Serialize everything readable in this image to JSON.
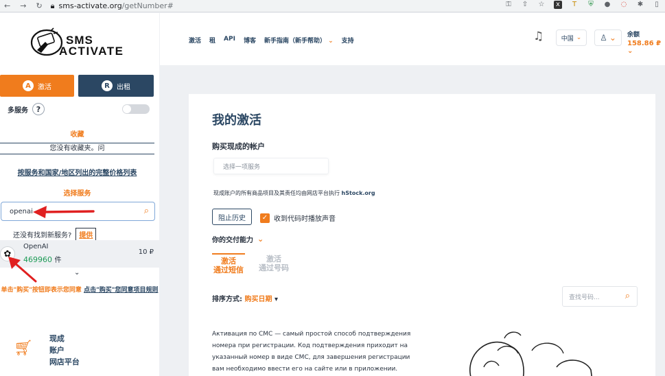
{
  "browser": {
    "url_host": "sms-activate.org",
    "url_path": "/getNumber#"
  },
  "sidebar": {
    "logo_line1": "SMS",
    "logo_line2": "ACTIVATE",
    "activate_btn": "激活",
    "rent_btn": "出租",
    "multi_service": "多服务",
    "help_mark": "?",
    "favorites_title": "收藏",
    "favorites_empty": "您没有收藏夹。问",
    "full_price_link": "按服务和国家/地区列出的完整价格列表",
    "choose_service": "选择服务",
    "search_value": "openai",
    "not_found": "还没有找到新服务?",
    "suggest": "提供",
    "service": {
      "name": "OpenAI",
      "count": "469960",
      "count_unit": "件",
      "price": "10 ₽"
    },
    "terms_prefix": "单击\"购买\"按钮即表示您同意",
    "terms_link": "点击\"购买\"您同意项目规则",
    "shop_line1": "现成",
    "shop_line2": "账户",
    "shop_line3": "网店平台"
  },
  "header": {
    "nav": [
      "激活",
      "租",
      "API",
      "博客",
      "新手指南（新手帮助）",
      "支持"
    ],
    "lang": "中国",
    "balance_label": "余额",
    "balance_amount": "158.86 ₽"
  },
  "main": {
    "title": "我的激活",
    "buy_accounts": "购买现成的帐户",
    "select_placeholder": "选择一项服务",
    "note": "现成账户的所有商品项目及其责任均由网店平台执行",
    "note_link": "hStock.org",
    "history_btn": "阻止历史",
    "sound_label": "收到代码时播放声音",
    "ability": "你的交付能力",
    "tab_sms_1": "激活",
    "tab_sms_2": "通过短信",
    "tab_num_1": "激活",
    "tab_num_2": "通过号码",
    "sort_label": "排序方式:",
    "sort_value": "购买日期",
    "number_search_placeholder": "查找号码...",
    "description": "Активация по СМС — самый простой способ подтверждения номера при регистрации. Код подтверждения приходит на указанный номер в виде СМС, для завершения регистрации вам необходимо ввести его на сайте или в приложении."
  },
  "colors": {
    "accent": "#f07c1d",
    "navy": "#2b4763",
    "green": "#1c9a55",
    "background": "#eef0f3"
  }
}
